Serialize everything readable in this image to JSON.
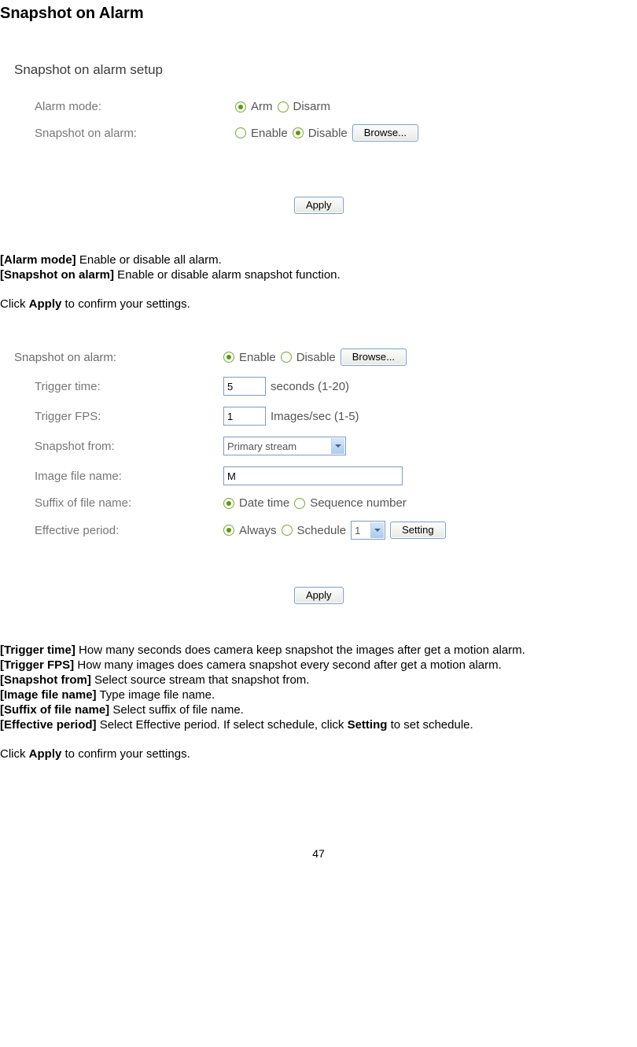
{
  "title": "Snapshot on Alarm",
  "panel1": {
    "heading": "Snapshot on alarm setup",
    "alarm_mode_label": "Alarm mode:",
    "arm": "Arm",
    "disarm": "Disarm",
    "snapshot_label": "Snapshot on alarm:",
    "enable": "Enable",
    "disable": "Disable",
    "browse": "Browse...",
    "apply": "Apply"
  },
  "desc1": {
    "alarm_mode_k": "[Alarm mode]",
    "alarm_mode_v": " Enable or disable all alarm.",
    "snapshot_k": "[Snapshot on alarm]",
    "snapshot_v": " Enable or disable alarm snapshot function.",
    "apply_pre": "Click ",
    "apply_b": "Apply",
    "apply_post": " to confirm your settings."
  },
  "panel2": {
    "snapshot_label": "Snapshot on alarm:",
    "enable": "Enable",
    "disable": "Disable",
    "browse": "Browse...",
    "trigger_time_label": "Trigger time:",
    "trigger_time_value": "5",
    "trigger_time_unit": "seconds (1-20)",
    "trigger_fps_label": "Trigger FPS:",
    "trigger_fps_value": "1",
    "trigger_fps_unit": "Images/sec (1-5)",
    "snapshot_from_label": "Snapshot from:",
    "snapshot_from_value": "Primary stream",
    "image_file_name_label": "Image file name:",
    "image_file_name_value": "M",
    "suffix_label": "Suffix of file name:",
    "suffix_datetime": "Date time",
    "suffix_seq": "Sequence number",
    "effective_label": "Effective period:",
    "eff_always": "Always",
    "eff_schedule": "Schedule",
    "eff_select": "1",
    "setting": "Setting",
    "apply": "Apply"
  },
  "desc2": {
    "trigger_time_k": "[Trigger time]",
    "trigger_time_v": " How many seconds does camera keep snapshot the images after get a motion alarm.",
    "trigger_fps_k": "[Trigger FPS]",
    "trigger_fps_v": " How many images does camera snapshot every second after get a motion alarm.",
    "snapshot_from_k": "[Snapshot from]",
    "snapshot_from_v": " Select source stream that snapshot from.",
    "image_file_name_k": "[Image file name]",
    "image_file_name_v": " Type image file name.",
    "suffix_k": "[Suffix of file name]",
    "suffix_v": " Select suffix of file name.",
    "effective_k": "[Effective period]",
    "effective_v1": " Select Effective period. If select schedule, click ",
    "effective_b": "Setting",
    "effective_v2": " to set schedule.",
    "apply_pre": "Click ",
    "apply_b": "Apply",
    "apply_post": " to confirm your settings."
  },
  "page_number": "47"
}
